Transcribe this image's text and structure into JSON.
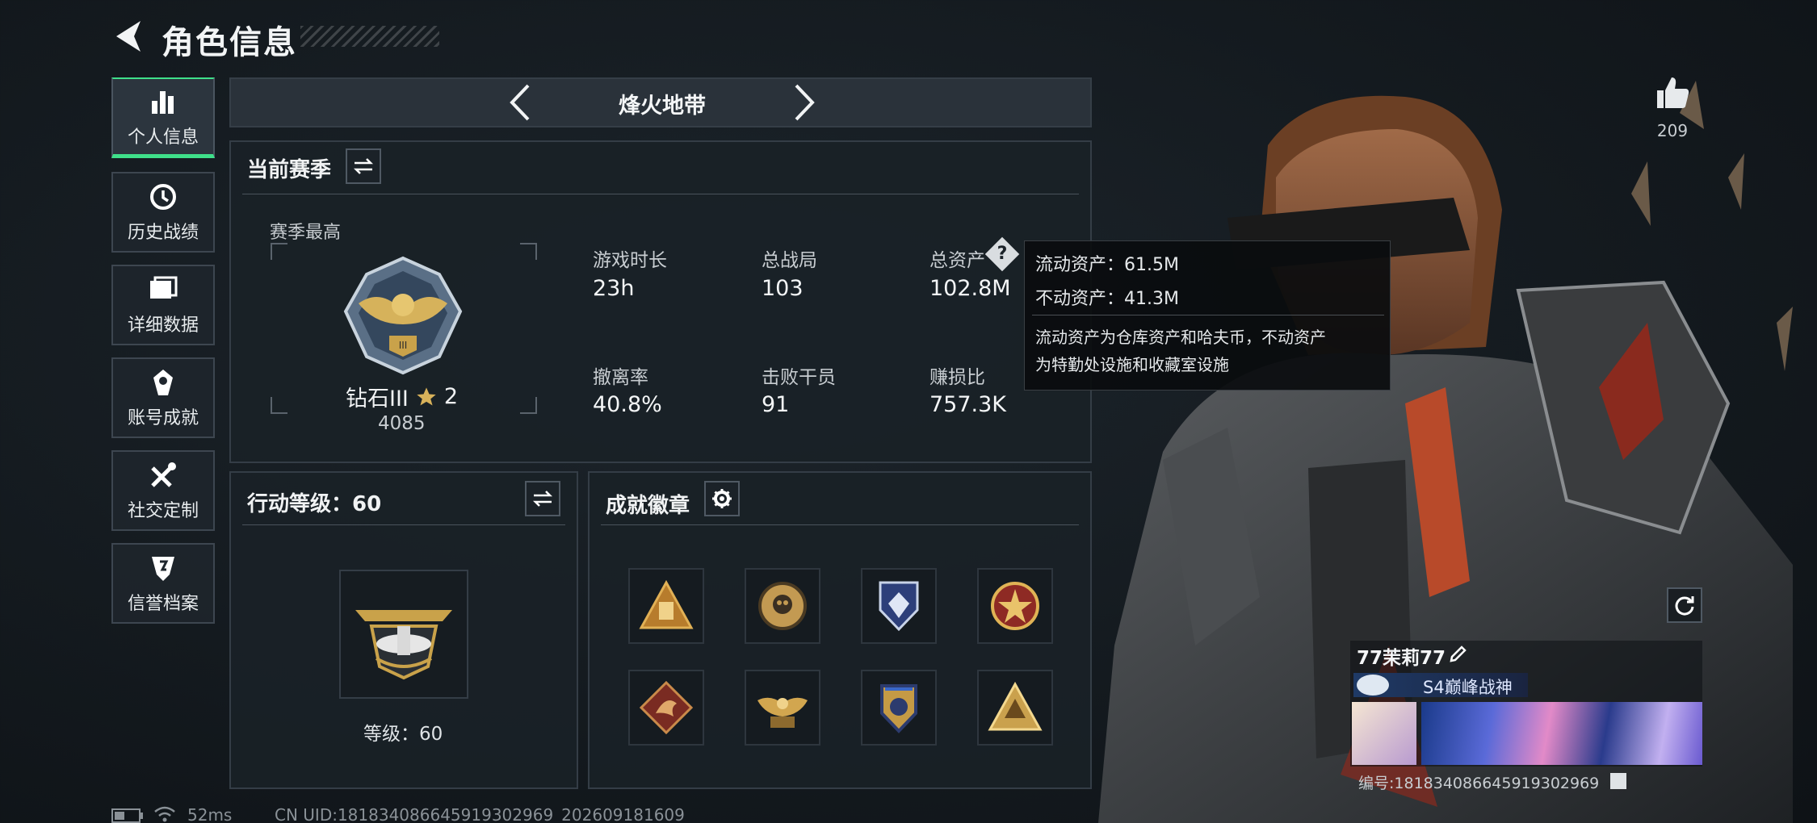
{
  "header": {
    "title": "角色信息"
  },
  "sidebar": {
    "items": [
      {
        "label": "个人信息",
        "icon": "bar-chart-icon",
        "active": true
      },
      {
        "label": "历史战绩",
        "icon": "history-icon"
      },
      {
        "label": "详细数据",
        "icon": "folder-icon"
      },
      {
        "label": "账号成就",
        "icon": "achievement-icon"
      },
      {
        "label": "社交定制",
        "icon": "tools-icon"
      },
      {
        "label": "信誉档案",
        "icon": "shield-icon"
      }
    ]
  },
  "mode_tabs": {
    "current": "烽火地带"
  },
  "season": {
    "title": "当前赛季",
    "best_label": "赛季最高",
    "rank_name": "钻石III",
    "rank_stars": "2",
    "rank_score": "4085",
    "stats": [
      {
        "label": "游戏时长",
        "value": "23h"
      },
      {
        "label": "总战局",
        "value": "103"
      },
      {
        "label": "总资产",
        "value": "102.8M"
      },
      {
        "label": "撤离率",
        "value": "40.8%"
      },
      {
        "label": "击败干员",
        "value": "91"
      },
      {
        "label": "赚损比",
        "value": "757.3K"
      }
    ]
  },
  "action_level": {
    "title": "行动等级：60",
    "level_text": "等级：60"
  },
  "achievements": {
    "title": "成就徽章",
    "badge_count_visible": 8
  },
  "tooltip": {
    "liquid": "流动资产：61.5M",
    "fixed": "不动资产：41.3M",
    "desc_line1": "流动资产为仓库资产和哈夫币，不动资产",
    "desc_line2": "为特勤处设施和收藏室设施"
  },
  "profile": {
    "likes": "209",
    "player_name": "77茉莉77",
    "title_badge": "S4巅峰战神",
    "id_text": "编号:1818340866459193029​69"
  },
  "status_bar": {
    "ping": "52ms",
    "uid": "CN UID:18183408664591930296​9_202609181609"
  },
  "colors": {
    "accent_green": "#3fe08a",
    "panel_bg": "#1a2127",
    "gold": "#c9a24a"
  }
}
